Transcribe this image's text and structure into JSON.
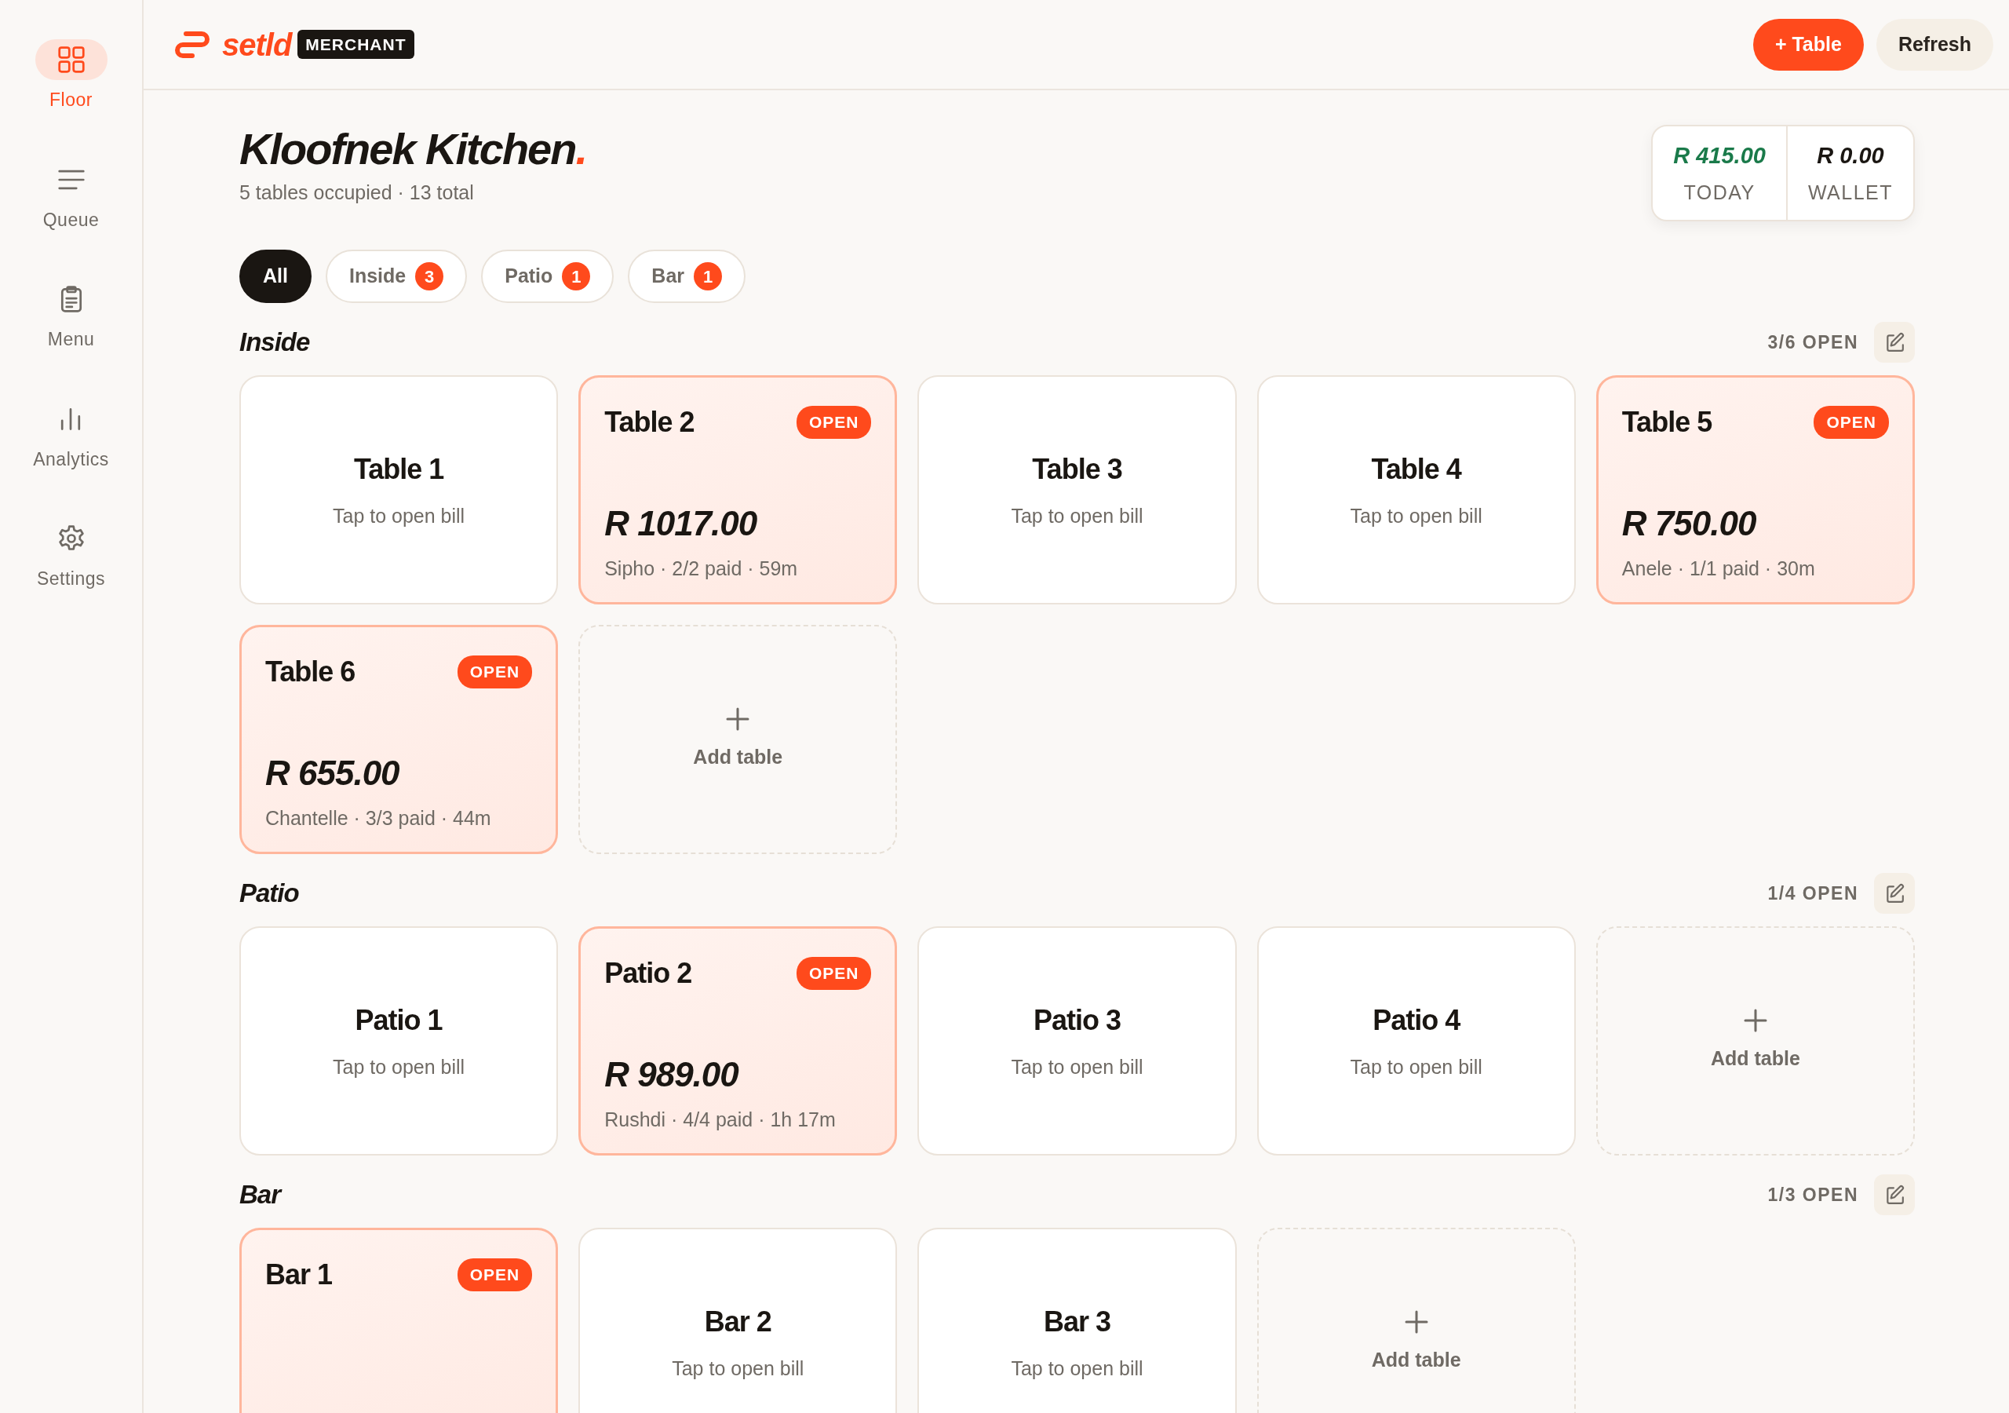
{
  "sidebar": {
    "items": [
      {
        "label": "Floor",
        "kind": "grid",
        "selected": true
      },
      {
        "label": "Queue",
        "kind": "lines",
        "selected": false
      },
      {
        "label": "Menu",
        "kind": "clipboard",
        "selected": false
      },
      {
        "label": "Analytics",
        "kind": "bars",
        "selected": false
      },
      {
        "label": "Settings",
        "kind": "gear",
        "selected": false
      }
    ]
  },
  "header": {
    "wordmark": "setld",
    "badge": "MERCHANT",
    "buttons": [
      {
        "label": "+ Table",
        "kind": "primary"
      },
      {
        "label": "Refresh",
        "kind": "secondary"
      }
    ]
  },
  "venue": {
    "name": "Kloofnek Kitchen",
    "accent": ".",
    "summary": "5 tables occupied · 13 total"
  },
  "stats": [
    {
      "value": "R 415.00",
      "label": "TODAY",
      "positive": true
    },
    {
      "value": "R 0.00",
      "label": "WALLET",
      "positive": false
    }
  ],
  "filters": [
    {
      "label": "All",
      "selected": true
    },
    {
      "label": "Inside",
      "count": "3",
      "selected": false
    },
    {
      "label": "Patio",
      "count": "1",
      "selected": false
    },
    {
      "label": "Bar",
      "count": "1",
      "selected": false
    }
  ],
  "sections": [
    {
      "title": "Inside",
      "open_count": "3/6 OPEN",
      "tables": [
        {
          "kind": "table",
          "name": "Table 1",
          "open": false,
          "hint": "Tap to open bill"
        },
        {
          "kind": "table",
          "name": "Table 2",
          "open": true,
          "badge": "OPEN",
          "amount": "R 1017.00",
          "details": "Sipho · 2/2 paid · 59m"
        },
        {
          "kind": "table",
          "name": "Table 3",
          "open": false,
          "hint": "Tap to open bill"
        },
        {
          "kind": "table",
          "name": "Table 4",
          "open": false,
          "hint": "Tap to open bill"
        },
        {
          "kind": "table",
          "name": "Table 5",
          "open": true,
          "badge": "OPEN",
          "amount": "R 750.00",
          "details": "Anele · 1/1 paid · 30m"
        },
        {
          "kind": "table",
          "name": "Table 6",
          "open": true,
          "badge": "OPEN",
          "amount": "R 655.00",
          "details": "Chantelle · 3/3 paid · 44m"
        },
        {
          "kind": "add",
          "label": "Add table"
        }
      ]
    },
    {
      "title": "Patio",
      "open_count": "1/4 OPEN",
      "tables": [
        {
          "kind": "table",
          "name": "Patio 1",
          "open": false,
          "hint": "Tap to open bill"
        },
        {
          "kind": "table",
          "name": "Patio 2",
          "open": true,
          "badge": "OPEN",
          "amount": "R 989.00",
          "details": "Rushdi · 4/4 paid · 1h 17m"
        },
        {
          "kind": "table",
          "name": "Patio 3",
          "open": false,
          "hint": "Tap to open bill"
        },
        {
          "kind": "table",
          "name": "Patio 4",
          "open": false,
          "hint": "Tap to open bill"
        },
        {
          "kind": "add",
          "label": "Add table"
        }
      ]
    },
    {
      "title": "Bar",
      "open_count": "1/3 OPEN",
      "tables": [
        {
          "kind": "table",
          "name": "Bar 1",
          "open": true,
          "badge": "OPEN"
        },
        {
          "kind": "table",
          "name": "Bar 2",
          "open": false,
          "hint": "Tap to open bill"
        },
        {
          "kind": "table",
          "name": "Bar 3",
          "open": false,
          "hint": "Tap to open bill"
        },
        {
          "kind": "add",
          "label": "Add table"
        }
      ]
    }
  ]
}
